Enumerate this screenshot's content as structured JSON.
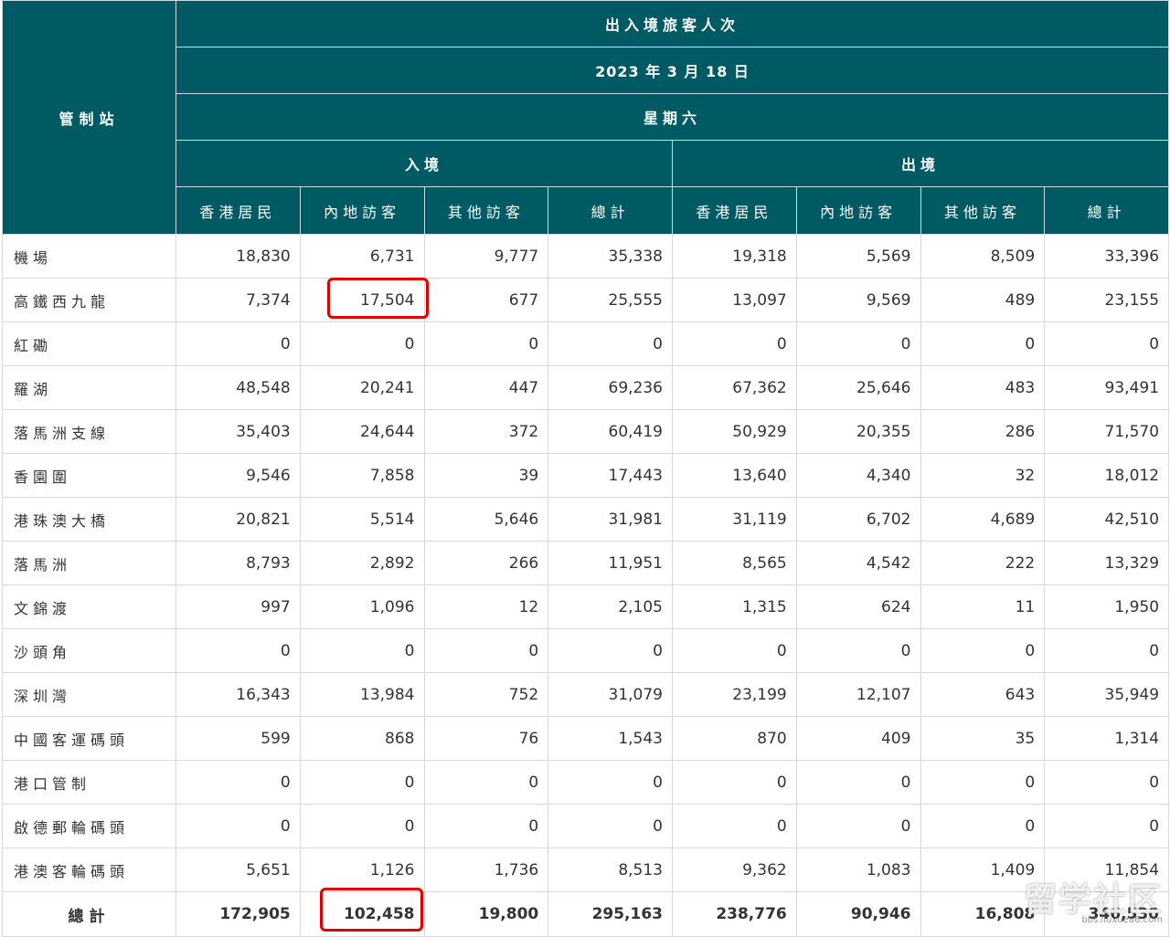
{
  "table": {
    "title": "出入境旅客人次",
    "date": "2023 年 3 月 18 日",
    "weekday": "星期六",
    "station_header": "管制站",
    "arrival_header": "入境",
    "departure_header": "出境",
    "sub_headers": [
      "香港居民",
      "內地訪客",
      "其他訪客",
      "總計",
      "香港居民",
      "內地訪客",
      "其他訪客",
      "總計"
    ],
    "rows": [
      {
        "name": "機場",
        "values": [
          "18,830",
          "6,731",
          "9,777",
          "35,338",
          "19,318",
          "5,569",
          "8,509",
          "33,396"
        ]
      },
      {
        "name": "高鐵西九龍",
        "values": [
          "7,374",
          "17,504",
          "677",
          "25,555",
          "13,097",
          "9,569",
          "489",
          "23,155"
        ]
      },
      {
        "name": "紅磡",
        "values": [
          "0",
          "0",
          "0",
          "0",
          "0",
          "0",
          "0",
          "0"
        ]
      },
      {
        "name": "羅湖",
        "values": [
          "48,548",
          "20,241",
          "447",
          "69,236",
          "67,362",
          "25,646",
          "483",
          "93,491"
        ]
      },
      {
        "name": "落馬洲支線",
        "values": [
          "35,403",
          "24,644",
          "372",
          "60,419",
          "50,929",
          "20,355",
          "286",
          "71,570"
        ]
      },
      {
        "name": "香園圍",
        "values": [
          "9,546",
          "7,858",
          "39",
          "17,443",
          "13,640",
          "4,340",
          "32",
          "18,012"
        ]
      },
      {
        "name": "港珠澳大橋",
        "values": [
          "20,821",
          "5,514",
          "5,646",
          "31,981",
          "31,119",
          "6,702",
          "4,689",
          "42,510"
        ]
      },
      {
        "name": "落馬洲",
        "values": [
          "8,793",
          "2,892",
          "266",
          "11,951",
          "8,565",
          "4,542",
          "222",
          "13,329"
        ]
      },
      {
        "name": "文錦渡",
        "values": [
          "997",
          "1,096",
          "12",
          "2,105",
          "1,315",
          "624",
          "11",
          "1,950"
        ]
      },
      {
        "name": "沙頭角",
        "values": [
          "0",
          "0",
          "0",
          "0",
          "0",
          "0",
          "0",
          "0"
        ]
      },
      {
        "name": "深圳灣",
        "values": [
          "16,343",
          "13,984",
          "752",
          "31,079",
          "23,199",
          "12,107",
          "643",
          "35,949"
        ]
      },
      {
        "name": "中國客運碼頭",
        "values": [
          "599",
          "868",
          "76",
          "1,543",
          "870",
          "409",
          "35",
          "1,314"
        ]
      },
      {
        "name": "港口管制",
        "values": [
          "0",
          "0",
          "0",
          "0",
          "0",
          "0",
          "0",
          "0"
        ]
      },
      {
        "name": "啟德郵輪碼頭",
        "values": [
          "0",
          "0",
          "0",
          "0",
          "0",
          "0",
          "0",
          "0"
        ]
      },
      {
        "name": "港澳客輪碼頭",
        "values": [
          "5,651",
          "1,126",
          "1,736",
          "8,513",
          "9,362",
          "1,083",
          "1,409",
          "11,854"
        ]
      }
    ],
    "total": {
      "name": "總計",
      "values": [
        "172,905",
        "102,458",
        "19,800",
        "295,163",
        "238,776",
        "90,946",
        "16,808",
        "346,530"
      ]
    }
  },
  "watermark": {
    "text": "留学社区",
    "url": "bbs.liuxue86.com"
  },
  "colors": {
    "header_bg": "#005a64",
    "highlight": "#e00000"
  }
}
